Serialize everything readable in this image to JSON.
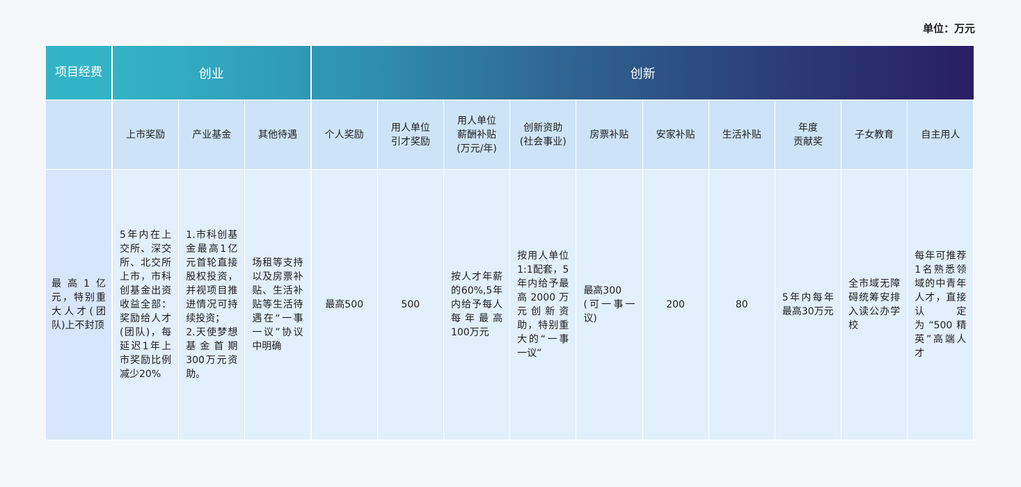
{
  "unit_label": "单位：万元",
  "header": {
    "corner": "项目\n经费",
    "startup": "创业",
    "innovation": "创新"
  },
  "columns": [
    "上市奖励",
    "产业基金",
    "其他待遇",
    "个人奖励",
    "用人单位\n引才奖励",
    "用人单位\n薪酬补贴\n(万元/年)",
    "创新资助\n(社会事业)",
    "房票补贴",
    "安家补贴",
    "生活补贴",
    "年度\n贡献奖",
    "子女教育",
    "自主用人"
  ],
  "row_label": "最高1亿元，特别重大人才(团队)上不封顶",
  "values": [
    "5年内在上交所、深交所、北交所上市，市科创基金出资收益全部：奖励给人才(团队)，每延迟1年上市奖励比例减少20%",
    "1.市科创基金最高1亿元首轮直接股权投资，并视项目推进情况可持续投资；\n2.天使梦想基金首期300万元资助。",
    "场租等支持以及房票补贴、生活补贴等生活待遇在“一事一议”协议中明确",
    "最高500",
    "500",
    "按人才年薪的60%,5年内给予每人每年最高100万元",
    "按用人单位1:1配套，5年内给予最高2000万元创新资助，特别重大的“一事一议”",
    "最高300\n(可一事一议)",
    "200",
    "80",
    "5年内每年最高30万元",
    "全市域无障碍统筹安排入读公办学校",
    "每年可推荐1名熟悉领域的中青年人才，直接认定为“500精英”高端人才"
  ]
}
